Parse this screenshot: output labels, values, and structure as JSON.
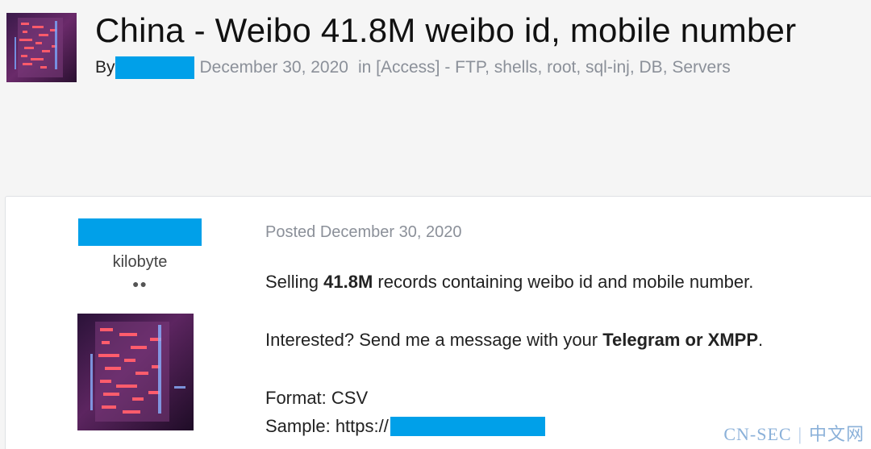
{
  "topic": {
    "title": "China - Weibo 41.8M weibo id, mobile number",
    "by_label": "By",
    "date": "December 30, 2020",
    "forum_text": "in [Access] - FTP, shells, root, sql-inj, DB, Servers"
  },
  "author": {
    "rank": "kilobyte",
    "reputation_dots": "●●"
  },
  "post": {
    "posted_label": "Posted December 30, 2020",
    "line1_pre": "Selling ",
    "line1_bold": "41.8M",
    "line1_post": " records containing weibo id and mobile number.",
    "line2_pre": "Interested? Send me a message with your ",
    "line2_bold": "Telegram or XMPP",
    "line2_post": ".",
    "format_line": "Format: CSV",
    "sample_label": "Sample: https://"
  },
  "watermark": {
    "left": "CN-SEC",
    "sep": "|",
    "right": "中文网"
  },
  "colors": {
    "redaction": "#00a0e9",
    "meta_gray": "#8b9099",
    "watermark": "#6f9ed0"
  },
  "icons": {
    "avatar": "glowing-server-rack-image"
  }
}
